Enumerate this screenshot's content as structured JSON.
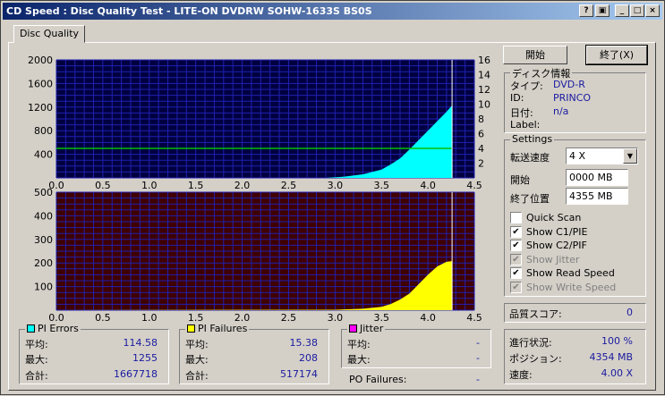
{
  "window": {
    "title": "CD Speed : Disc Quality Test - LITE-ON DVDRW SOHW-1633S BS0S",
    "btn_help": "?",
    "btn_copy": "▣",
    "btn_min": "_",
    "btn_max": "□",
    "btn_close": "×"
  },
  "tab": {
    "label": "Disc Quality"
  },
  "buttons": {
    "start": "開始",
    "end": "終了(X)"
  },
  "disc_info": {
    "title": "ディスク情報",
    "type_label": "タイプ:",
    "type_value": "DVD-R",
    "id_label": "ID:",
    "id_value": "PRINCO",
    "date_label": "日付:",
    "date_value": "n/a",
    "label_label": "Label:",
    "label_value": ""
  },
  "settings": {
    "title": "Settings",
    "speed_label": "転送速度",
    "speed_value": "4 X",
    "start_label": "開始",
    "start_value": "0000 MB",
    "end_label": "終了位置",
    "end_value": "4355 MB",
    "checks": [
      {
        "label": "Quick Scan",
        "checked": false,
        "disabled": false
      },
      {
        "label": "Show C1/PIE",
        "checked": true,
        "disabled": false
      },
      {
        "label": "Show C2/PIF",
        "checked": true,
        "disabled": false
      },
      {
        "label": "Show Jitter",
        "checked": true,
        "disabled": true
      },
      {
        "label": "Show Read Speed",
        "checked": true,
        "disabled": false
      },
      {
        "label": "Show Write Speed",
        "checked": true,
        "disabled": true
      }
    ]
  },
  "quality": {
    "label": "品質スコア:",
    "value": "0"
  },
  "progress": {
    "progress_label": "進行状況:",
    "progress_value": "100 %",
    "position_label": "ポジション:",
    "position_value": "4354 MB",
    "speed_label": "速度:",
    "speed_value": "4.00 X"
  },
  "pi_errors": {
    "title": "PI Errors",
    "color": "#00ffff",
    "avg_label": "平均:",
    "avg_value": "114.58",
    "max_label": "最大:",
    "max_value": "1255",
    "total_label": "合計:",
    "total_value": "1667718"
  },
  "pi_failures": {
    "title": "PI Failures",
    "color": "#ffff00",
    "avg_label": "平均:",
    "avg_value": "15.38",
    "max_label": "最大:",
    "max_value": "208",
    "total_label": "合計:",
    "total_value": "517174"
  },
  "jitter": {
    "title": "Jitter",
    "color": "#ff00ff",
    "avg_label": "平均:",
    "avg_value": "-",
    "max_label": "最大:",
    "max_value": "-"
  },
  "po_failures": {
    "label": "PO Failures:",
    "value": "-"
  },
  "chart_data": [
    {
      "type": "area",
      "x_ticks": [
        "0.0",
        "0.5",
        "1.0",
        "1.5",
        "2.0",
        "2.5",
        "3.0",
        "3.5",
        "4.0",
        "4.5"
      ],
      "y_ticks_left": [
        "400",
        "800",
        "1200",
        "1600",
        "2000"
      ],
      "y_ticks_right": [
        "2",
        "4",
        "6",
        "8",
        "10",
        "12",
        "14",
        "16"
      ],
      "xlim": [
        0,
        4.5
      ],
      "ylim": [
        0,
        2000
      ],
      "y2lim": [
        0,
        16
      ],
      "bg_color": "#000040",
      "grid_color": "#2020b0",
      "area_color": "#00ffff",
      "line_color": "#00c000",
      "series": [
        {
          "values_x": [
            0,
            2.9,
            3.1,
            3.3,
            3.5,
            3.6,
            3.7,
            3.8,
            3.9,
            4.0,
            4.1,
            4.2,
            4.26
          ],
          "values_y": [
            0,
            0,
            20,
            60,
            140,
            230,
            330,
            480,
            640,
            800,
            960,
            1120,
            1230
          ]
        },
        {
          "values_x": [
            0,
            4.26
          ],
          "values_y2": [
            4,
            4
          ]
        }
      ],
      "end_marker_x": 4.26
    },
    {
      "type": "area",
      "x_ticks": [
        "0.0",
        "0.5",
        "1.0",
        "1.5",
        "2.0",
        "2.5",
        "3.0",
        "3.5",
        "4.0",
        "4.5"
      ],
      "y_ticks_left": [
        "100",
        "200",
        "300",
        "400",
        "500"
      ],
      "xlim": [
        0,
        4.5
      ],
      "ylim": [
        0,
        500
      ],
      "bg_color": "#400000",
      "grid_color": "#2020b0",
      "area_color": "#ffff00",
      "series": [
        {
          "values_x": [
            0,
            3.0,
            3.3,
            3.5,
            3.6,
            3.7,
            3.8,
            3.9,
            4.0,
            4.1,
            4.2,
            4.26
          ],
          "values_y": [
            0,
            2,
            6,
            14,
            26,
            45,
            70,
            110,
            150,
            185,
            205,
            208
          ]
        }
      ],
      "end_marker_x": 4.26
    }
  ]
}
